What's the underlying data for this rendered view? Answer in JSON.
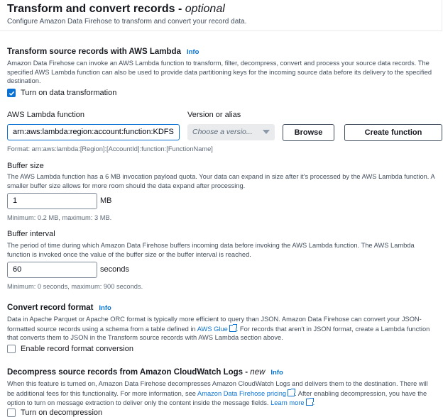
{
  "header": {
    "title": "Transform and convert records - ",
    "title_suffix": "optional",
    "subtitle": "Configure Amazon Data Firehose to transform and convert your record data."
  },
  "transform": {
    "heading": "Transform source records with AWS Lambda",
    "info": "Info",
    "description": "Amazon Data Firehose can invoke an AWS Lambda function to transform, filter, decompress, convert and process your source data records. The specified AWS Lambda function can also be used to provide data partitioning keys for the incoming source data before its delivery to the specified destination.",
    "checkbox_label": "Turn on data transformation",
    "checkbox_checked": true,
    "lambda_label": "AWS Lambda function",
    "lambda_value": "arn:aws:lambda:region:account:function:KDFS",
    "version_label": "Version or alias",
    "version_placeholder": "Choose a versio...",
    "browse_label": "Browse",
    "create_label": "Create function",
    "format_hint": "Format: arn:aws:lambda:[Region]:[AccountId]:function:[FunctionName]",
    "buffer_size_label": "Buffer size",
    "buffer_size_desc": "The AWS Lambda function has a 6 MB invocation payload quota. Your data can expand in size after it's processed by the AWS Lambda function. A smaller buffer size allows for more room should the data expand after processing.",
    "buffer_size_value": "1",
    "buffer_size_unit": "MB",
    "buffer_size_hint": "Minimum: 0.2 MB, maximum: 3 MB.",
    "buffer_interval_label": "Buffer interval",
    "buffer_interval_desc": "The period of time during which Amazon Data Firehose buffers incoming data before invoking the AWS Lambda function. The AWS Lambda function is invoked once the value of the buffer size or the buffer interval is reached.",
    "buffer_interval_value": "60",
    "buffer_interval_unit": "seconds",
    "buffer_interval_hint": "Minimum: 0 seconds, maximum: 900 seconds."
  },
  "convert": {
    "heading": "Convert record format",
    "info": "Info",
    "desc_part1": "Data in Apache Parquet or Apache ORC format is typically more efficient to query than JSON. Amazon Data Firehose can convert your JSON-formatted source records using a schema from a table defined in ",
    "desc_link": "AWS Glue",
    "desc_part2": ". For records that aren't in JSON format, create a Lambda function that converts them to JSON in the Transform source records with AWS Lambda section above.",
    "checkbox_label": "Enable record format conversion",
    "checkbox_checked": false
  },
  "decompress": {
    "heading": "Decompress source records from Amazon CloudWatch Logs - ",
    "heading_suffix": "new",
    "info": "Info",
    "desc_part1": "When this feature is turned on, Amazon Data Firehose decompresses Amazon CloudWatch Logs and delivers them to the destination. There will be additional fees for this functionality. For more information, see ",
    "desc_link1": "Amazon Data Firehose pricing",
    "desc_part2": ". After enabling decompression, you have the option to turn on message extraction to deliver only the content inside the message fields. ",
    "desc_link2": "Learn more",
    "checkbox_label": "Turn on decompression",
    "checkbox_checked": false
  }
}
